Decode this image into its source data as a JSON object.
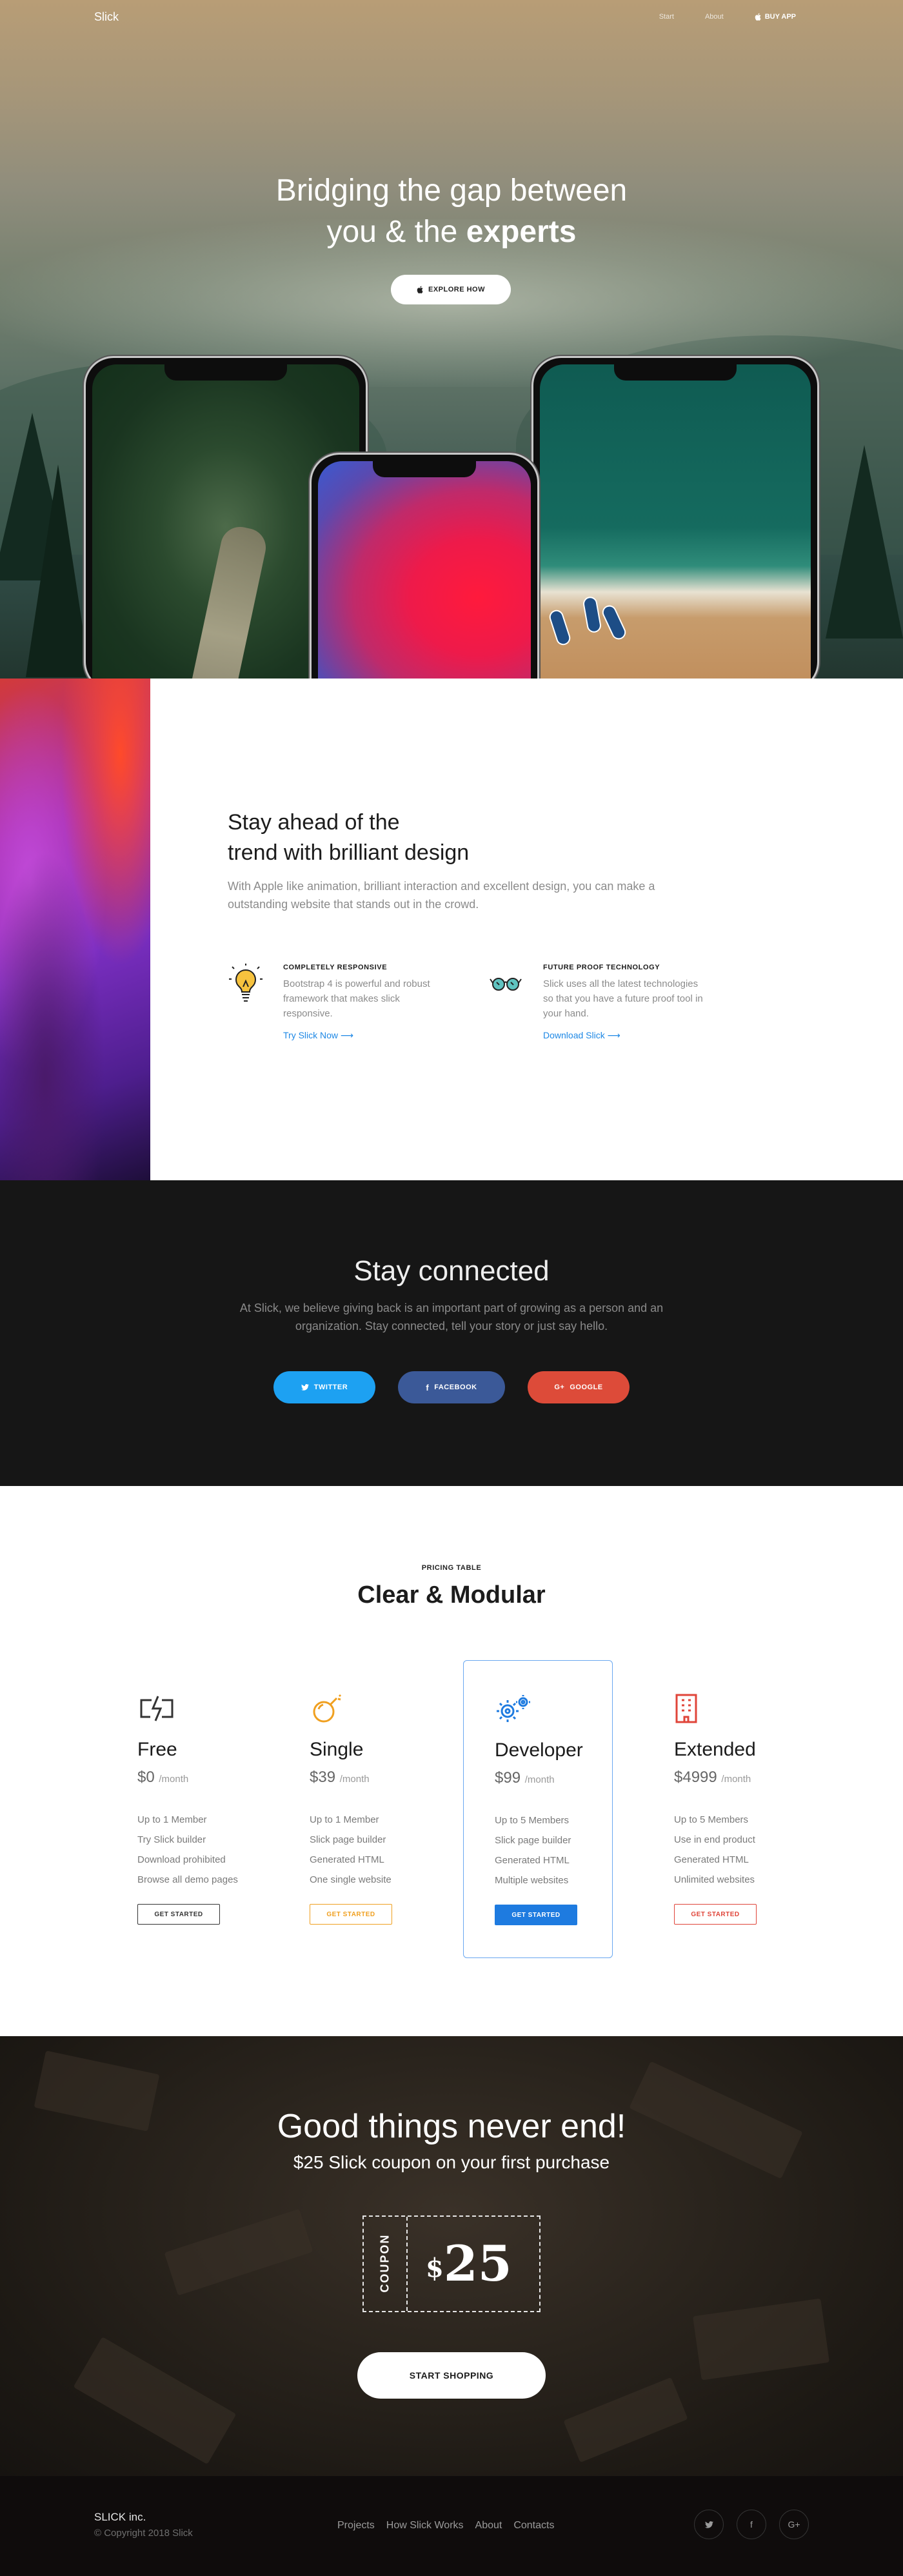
{
  "nav": {
    "logo": "Slick",
    "links": [
      "Start",
      "About"
    ],
    "buy_label": "BUY APP"
  },
  "hero": {
    "title_line1": "Bridging the gap between",
    "title_line2_pre": "you & the ",
    "title_line2_bold": "experts",
    "explore_label": "EXPLORE HOW"
  },
  "feature": {
    "title_line1": "Stay ahead of the",
    "title_line2": "trend with brilliant design",
    "subtitle": "With Apple like animation, brilliant interaction and excellent design, you can make a outstanding website that stands out in the crowd.",
    "cards": [
      {
        "icon": "lightbulb-icon",
        "heading": "COMPLETELY RESPONSIVE",
        "text": "Bootstrap 4 is powerful and robust framework that makes slick responsive.",
        "link": "Try Slick Now ⟶"
      },
      {
        "icon": "glasses-icon",
        "heading": "FUTURE PROOF TECHNOLOGY",
        "text": "Slick uses all the latest technologies so that you have a future proof tool in your hand.",
        "link": "Download Slick ⟶"
      }
    ]
  },
  "connect": {
    "title": "Stay connected",
    "subtitle": "At Slick, we believe giving back is an important part of growing as a person and an organization. Stay connected, tell your story or just say hello.",
    "buttons": [
      {
        "label": "TWITTER",
        "icon": "twitter-icon",
        "color": "#1da1f2"
      },
      {
        "label": "FACEBOOK",
        "icon": "facebook-icon",
        "color": "#3b5998"
      },
      {
        "label": "GOOGLE",
        "icon": "google-plus-icon",
        "color": "#dd4b39"
      }
    ]
  },
  "pricing": {
    "kicker": "PRICING TABLE",
    "title_pre": "Clear & ",
    "title_bold": "Modular",
    "plans": [
      {
        "name": "Free",
        "price": "$0",
        "period": "/month",
        "icon": "power-bolt-icon",
        "color": "#333333",
        "features": [
          "Up to 1 Member",
          "Try Slick builder",
          "Download prohibited",
          "Browse all demo pages"
        ],
        "cta": "GET STARTED"
      },
      {
        "name": "Single",
        "price": "$39",
        "period": "/month",
        "icon": "bomb-icon",
        "color": "#f0a020",
        "features": [
          "Up to 1 Member",
          "Slick page builder",
          "Generated HTML",
          "One single website"
        ],
        "cta": "GET STARTED"
      },
      {
        "name": "Developer",
        "price": "$99",
        "period": "/month",
        "icon": "gears-icon",
        "color": "#1e7be0",
        "features": [
          "Up to 5 Members",
          "Slick page builder",
          "Generated HTML",
          "Multiple websites"
        ],
        "cta": "GET STARTED"
      },
      {
        "name": "Extended",
        "price": "$4999",
        "period": "/month",
        "icon": "building-icon",
        "color": "#e0453a",
        "features": [
          "Up to 5 Members",
          "Use in end product",
          "Generated HTML",
          "Unlimited websites"
        ],
        "cta": "GET STARTED"
      }
    ]
  },
  "coupon": {
    "title": "Good things never end!",
    "subtitle": "$25 Slick coupon on your first purchase",
    "label": "COUPON",
    "currency": "$",
    "amount": "25",
    "cta": "START SHOPPING"
  },
  "footer": {
    "brand": "SLICK inc.",
    "copyright": "© Copyright 2018 Slick",
    "links": [
      "Projects",
      "How Slick Works",
      "About",
      "Contacts"
    ],
    "social": [
      "twitter-icon",
      "facebook-icon",
      "google-plus-icon"
    ]
  }
}
